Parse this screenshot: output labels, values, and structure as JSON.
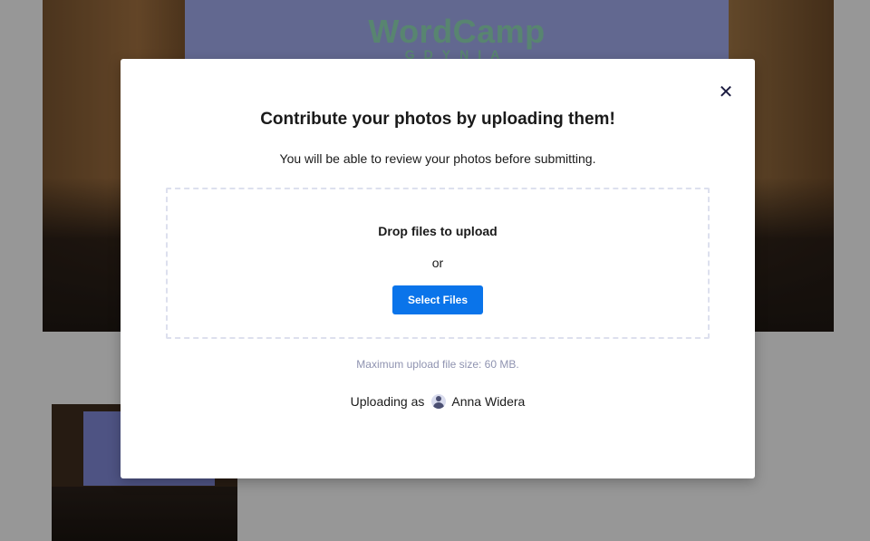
{
  "background": {
    "photo_large_screen_text": "WordCamp",
    "photo_large_screen_subtext": "GDYNIA"
  },
  "modal": {
    "close_icon": "close-icon",
    "title": "Contribute your photos by uploading them!",
    "subtitle": "You will be able to review your photos before submitting.",
    "dropzone": {
      "drop_label": "Drop files to upload",
      "or_label": "or",
      "select_button_label": "Select Files"
    },
    "max_upload_size": "Maximum upload file size: 60 MB.",
    "uploading_as_label": "Uploading as",
    "user_avatar_icon": "user-avatar-icon",
    "user_name": "Anna Widera"
  },
  "colors": {
    "accent_button": "#0a74ea",
    "muted_text": "#8f93b0",
    "dropzone_border": "#dde0ee"
  }
}
